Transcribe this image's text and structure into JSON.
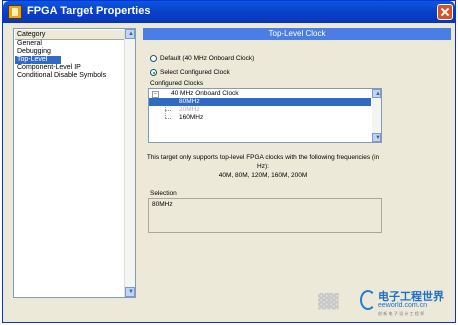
{
  "window": {
    "title": "FPGA Target Properties"
  },
  "category": {
    "header": "Category",
    "items": [
      "General",
      "Debugging",
      "Top-Level Clock",
      "Component-Level IP",
      "Conditional Disable Symbols"
    ],
    "selected_index": 2
  },
  "panel": {
    "header": "Top-Level Clock",
    "radio_default": "Default (40 MHz Onboard Clock)",
    "radio_select": "Select Configured Clock",
    "selected_radio": "radio_select",
    "configured_label": "Configured Clocks",
    "tree": {
      "root": "40 MHz Onboard Clock",
      "children": [
        "80MHz",
        "20MHz",
        "160MHz"
      ],
      "selected_child": "80MHz"
    },
    "info_line1": "This target only supports top-level FPGA clocks with the following frequencies (in Hz):",
    "info_line2": "40M, 80M, 120M, 160M, 200M",
    "selection_label": "Selection",
    "selection_value": "80MHz"
  },
  "watermark": {
    "cn_title": "电子工程世界",
    "url": "eeworld.com.cn",
    "sub": "创 新 电 子 设 计 工 程 师"
  },
  "colors": {
    "titlebar": "#0a58e0",
    "selection": "#316ac5",
    "panel_header": "#4a7ee6"
  }
}
